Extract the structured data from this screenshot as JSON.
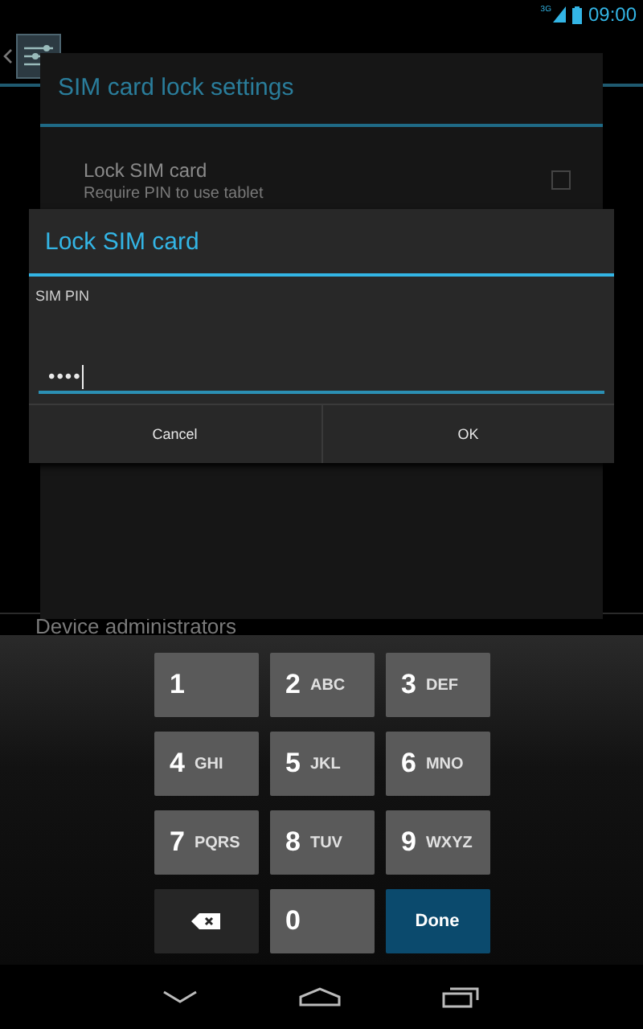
{
  "status_bar": {
    "network": "3G",
    "time": "09:00"
  },
  "background_list": {
    "items": [
      "Device administrators"
    ]
  },
  "settings_dialog": {
    "title": "SIM card lock settings",
    "option": {
      "label": "Lock SIM card",
      "description": "Require PIN to use tablet",
      "checked": false
    }
  },
  "pin_dialog": {
    "title": "Lock SIM card",
    "field_label": "SIM PIN",
    "value": "••••",
    "buttons": [
      "Cancel",
      "OK"
    ]
  },
  "keypad": {
    "keys": [
      {
        "kind": "digit",
        "digit": "1"
      },
      {
        "kind": "digit",
        "digit": "2",
        "letters": "ABC"
      },
      {
        "kind": "digit",
        "digit": "3",
        "letters": "DEF"
      },
      {
        "kind": "digit",
        "digit": "4",
        "letters": "GHI"
      },
      {
        "kind": "digit",
        "digit": "5",
        "letters": "JKL"
      },
      {
        "kind": "digit",
        "digit": "6",
        "letters": "MNO"
      },
      {
        "kind": "digit",
        "digit": "7",
        "letters": "PQRS"
      },
      {
        "kind": "digit",
        "digit": "8",
        "letters": "TUV"
      },
      {
        "kind": "digit",
        "digit": "9",
        "letters": "WXYZ"
      },
      {
        "kind": "backspace"
      },
      {
        "kind": "digit",
        "digit": "0"
      },
      {
        "kind": "done",
        "label": "Done"
      }
    ]
  }
}
